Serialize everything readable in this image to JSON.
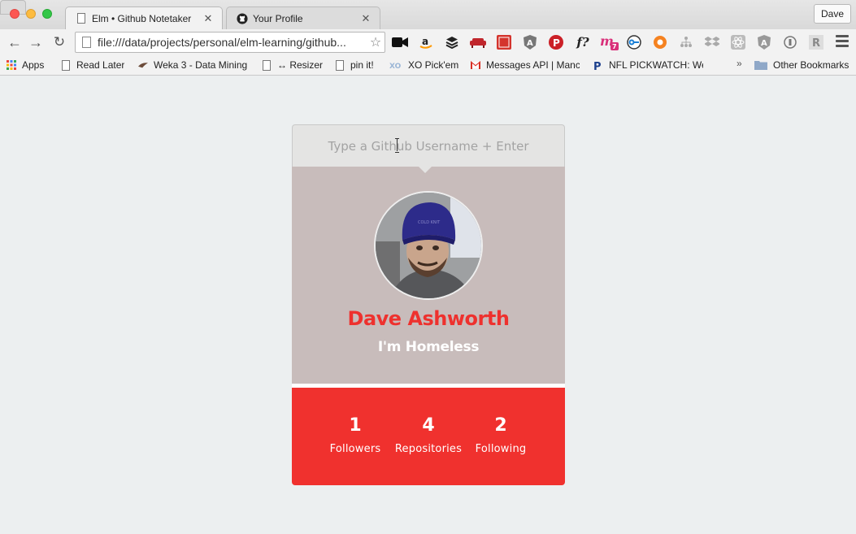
{
  "browser": {
    "tabs": [
      {
        "title": "Elm • Github Notetaker",
        "active": true
      },
      {
        "title": "Your Profile",
        "active": false
      }
    ],
    "profile_button": "Dave",
    "url": "file:///data/projects/personal/elm-learning/github...",
    "extensions": [
      "video-camera-icon",
      "amazon-icon",
      "buffer-icon",
      "couch-icon",
      "feed-icon",
      "angular-shield-icon",
      "pinterest-icon",
      "font-detect-icon",
      "m-badge-icon",
      "key-icon",
      "lifebuoy-icon",
      "sitemap-icon",
      "dropbox-icon",
      "react-icon",
      "angular-icon",
      "circle-icon",
      "r-icon"
    ],
    "font_detect_label": "f?",
    "m_badge_count": "7",
    "bookmarks": [
      {
        "label": "Apps",
        "icon": "apps-grid-icon"
      },
      {
        "label": "Read Later",
        "icon": "page-icon"
      },
      {
        "label": "Weka 3 - Data Mining",
        "icon": "weka-bird-icon"
      },
      {
        "label": "↔ Resizer",
        "icon": "page-icon"
      },
      {
        "label": "pin it!",
        "icon": "page-icon"
      },
      {
        "label": "XO Pick'em",
        "icon": "xo-icon"
      },
      {
        "label": "Messages API | Manc",
        "icon": "gmail-icon"
      },
      {
        "label": "NFL PICKWATCH: We",
        "icon": "p-icon"
      }
    ],
    "more_bookmarks": "»",
    "other_bookmarks": "Other Bookmarks"
  },
  "app": {
    "search": {
      "placeholder": "Type a Github Username + Enter",
      "value": ""
    },
    "profile": {
      "name": "Dave Ashworth",
      "bio": "I'm Homeless"
    },
    "stats": [
      {
        "value": "1",
        "label": "Followers"
      },
      {
        "value": "4",
        "label": "Repositories"
      },
      {
        "value": "2",
        "label": "Following"
      }
    ]
  },
  "colors": {
    "accent_red": "#f0312e",
    "name_red": "#ee312e",
    "profile_bg": "#c8bcbb",
    "page_bg": "#eceff0"
  }
}
